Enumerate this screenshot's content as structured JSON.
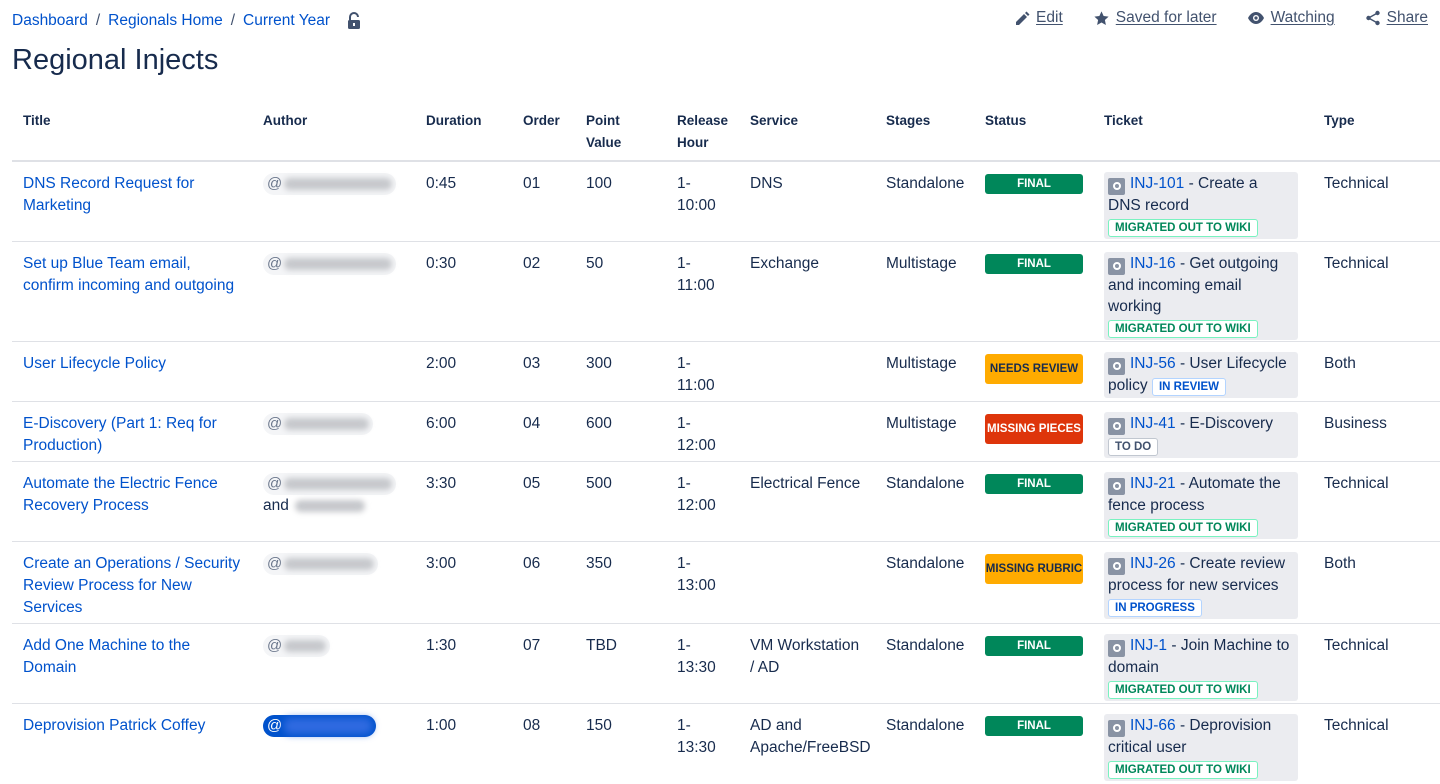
{
  "breadcrumb": [
    "Dashboard",
    "Regionals Home",
    "Current Year"
  ],
  "actions": {
    "edit": "Edit",
    "saved": "Saved for later",
    "watching": "Watching",
    "share": "Share"
  },
  "page_title": "Regional Injects",
  "columns": [
    "Title",
    "Author",
    "Duration",
    "Order",
    "Point Value",
    "Release Hour",
    "Service",
    "Stages",
    "Status",
    "Ticket",
    "Type"
  ],
  "rows": [
    {
      "title": "DNS Record Request for Marketing",
      "author_at": "@",
      "duration": "0:45",
      "order": "01",
      "points": "100",
      "release": "1-10:00",
      "service": "DNS",
      "stages": "Standalone",
      "status": "FINAL",
      "ticket_key": "INJ-101",
      "ticket_text": " - Create a DNS record",
      "ticket_status": "MIGRATED OUT TO WIKI",
      "type": "Technical"
    },
    {
      "title": "Set up Blue Team email, confirm incoming and outgoing",
      "author_at": "@",
      "duration": "0:30",
      "order": "02",
      "points": "50",
      "release": "1-11:00",
      "service": "Exchange",
      "stages": "Multistage",
      "status": "FINAL",
      "ticket_key": "INJ-16",
      "ticket_text": " - Get outgoing and incoming email working",
      "ticket_status": "MIGRATED OUT TO WIKI",
      "type": "Technical"
    },
    {
      "title": "User Lifecycle Policy",
      "author_at": "",
      "duration": "2:00",
      "order": "03",
      "points": "300",
      "release": "1-11:00",
      "service": "",
      "stages": "Multistage",
      "status": "NEEDS REVIEW",
      "ticket_key": "INJ-56",
      "ticket_text": " - User Lifecycle policy",
      "ticket_status": "IN REVIEW",
      "type": "Both"
    },
    {
      "title": "E-Discovery (Part 1: Req for Production)",
      "author_at": "@",
      "duration": "6:00",
      "order": "04",
      "points": "600",
      "release": "1-12:00",
      "service": "",
      "stages": "Multistage",
      "status": "MISSING PIECES",
      "ticket_key": "INJ-41",
      "ticket_text": " - E-Discovery",
      "ticket_status": "TO DO",
      "type": "Business"
    },
    {
      "title": "Automate the Electric Fence Recovery Process",
      "author_at": "@",
      "author_and": "and",
      "duration": "3:30",
      "order": "05",
      "points": "500",
      "release": "1-12:00",
      "service": "Electrical Fence",
      "stages": "Standalone",
      "status": "FINAL",
      "ticket_key": "INJ-21",
      "ticket_text": " - Automate the fence process",
      "ticket_status": "MIGRATED OUT TO WIKI",
      "type": "Technical"
    },
    {
      "title": "Create an Operations / Security Review Process for New Services",
      "author_at": "@",
      "duration": "3:00",
      "order": "06",
      "points": "350",
      "release": "1-13:00",
      "service": "",
      "stages": "Standalone",
      "status": "MISSING RUBRIC",
      "ticket_key": "INJ-26",
      "ticket_text": " - Create review process for new services",
      "ticket_status": "IN PROGRESS",
      "type": "Both"
    },
    {
      "title": "Add One Machine to the Domain",
      "author_at": "@",
      "duration": "1:30",
      "order": "07",
      "points": "TBD",
      "release": "1-13:30",
      "service": "VM Workstation / AD",
      "stages": "Standalone",
      "status": "FINAL",
      "ticket_key": "INJ-1",
      "ticket_text": " - Join Machine to domain",
      "ticket_status": "MIGRATED OUT TO WIKI",
      "type": "Technical"
    },
    {
      "title": "Deprovision Patrick Coffey",
      "author_at": "@",
      "duration": "1:00",
      "order": "08",
      "points": "150",
      "release": "1-13:30",
      "service": "AD and Apache/FreeBSD",
      "stages": "Standalone",
      "status": "FINAL",
      "ticket_key": "INJ-66",
      "ticket_text": " - Deprovision critical user",
      "ticket_status": "MIGRATED OUT TO WIKI",
      "type": "Technical"
    }
  ],
  "colors": {
    "link": "#0052cc",
    "final": "#00875a",
    "needs": "#ffab00",
    "missing_pieces": "#de350b"
  }
}
